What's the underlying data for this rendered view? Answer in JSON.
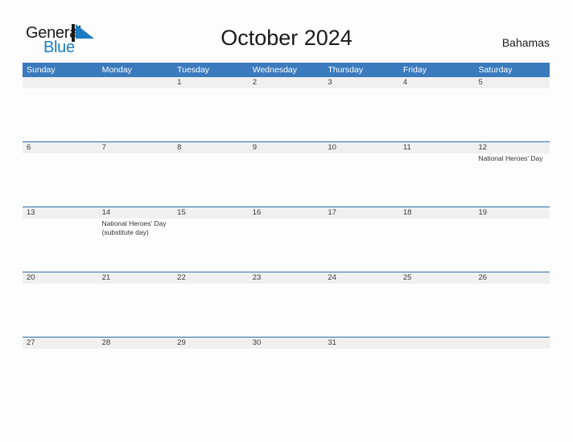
{
  "brand": {
    "name_part1": "General",
    "name_part2": "Blue",
    "logo_icon": "blue-triangle-flag-icon",
    "dark_color": "#1a1a1a",
    "blue_color": "#1c7cc4"
  },
  "header": {
    "title": "October 2024",
    "country": "Bahamas"
  },
  "theme": {
    "header_blue": "#3a7abd",
    "rule_blue": "#2b6ca8",
    "band_gray": "#f0f0f0",
    "page_bg": "#fdfdfd",
    "text_color": "#3a3a3a"
  },
  "calendar": {
    "day_headers": [
      "Sunday",
      "Monday",
      "Tuesday",
      "Wednesday",
      "Thursday",
      "Friday",
      "Saturday"
    ],
    "weeks": [
      {
        "days": [
          {
            "number": "",
            "events": []
          },
          {
            "number": "",
            "events": []
          },
          {
            "number": "1",
            "events": []
          },
          {
            "number": "2",
            "events": []
          },
          {
            "number": "3",
            "events": []
          },
          {
            "number": "4",
            "events": []
          },
          {
            "number": "5",
            "events": []
          }
        ]
      },
      {
        "days": [
          {
            "number": "6",
            "events": []
          },
          {
            "number": "7",
            "events": []
          },
          {
            "number": "8",
            "events": []
          },
          {
            "number": "9",
            "events": []
          },
          {
            "number": "10",
            "events": []
          },
          {
            "number": "11",
            "events": []
          },
          {
            "number": "12",
            "events": [
              "National Heroes' Day"
            ]
          }
        ]
      },
      {
        "days": [
          {
            "number": "13",
            "events": []
          },
          {
            "number": "14",
            "events": [
              "National Heroes' Day (substitute day)"
            ]
          },
          {
            "number": "15",
            "events": []
          },
          {
            "number": "16",
            "events": []
          },
          {
            "number": "17",
            "events": []
          },
          {
            "number": "18",
            "events": []
          },
          {
            "number": "19",
            "events": []
          }
        ]
      },
      {
        "days": [
          {
            "number": "20",
            "events": []
          },
          {
            "number": "21",
            "events": []
          },
          {
            "number": "22",
            "events": []
          },
          {
            "number": "23",
            "events": []
          },
          {
            "number": "24",
            "events": []
          },
          {
            "number": "25",
            "events": []
          },
          {
            "number": "26",
            "events": []
          }
        ]
      },
      {
        "days": [
          {
            "number": "27",
            "events": []
          },
          {
            "number": "28",
            "events": []
          },
          {
            "number": "29",
            "events": []
          },
          {
            "number": "30",
            "events": []
          },
          {
            "number": "31",
            "events": []
          },
          {
            "number": "",
            "events": []
          },
          {
            "number": "",
            "events": []
          }
        ]
      }
    ]
  }
}
